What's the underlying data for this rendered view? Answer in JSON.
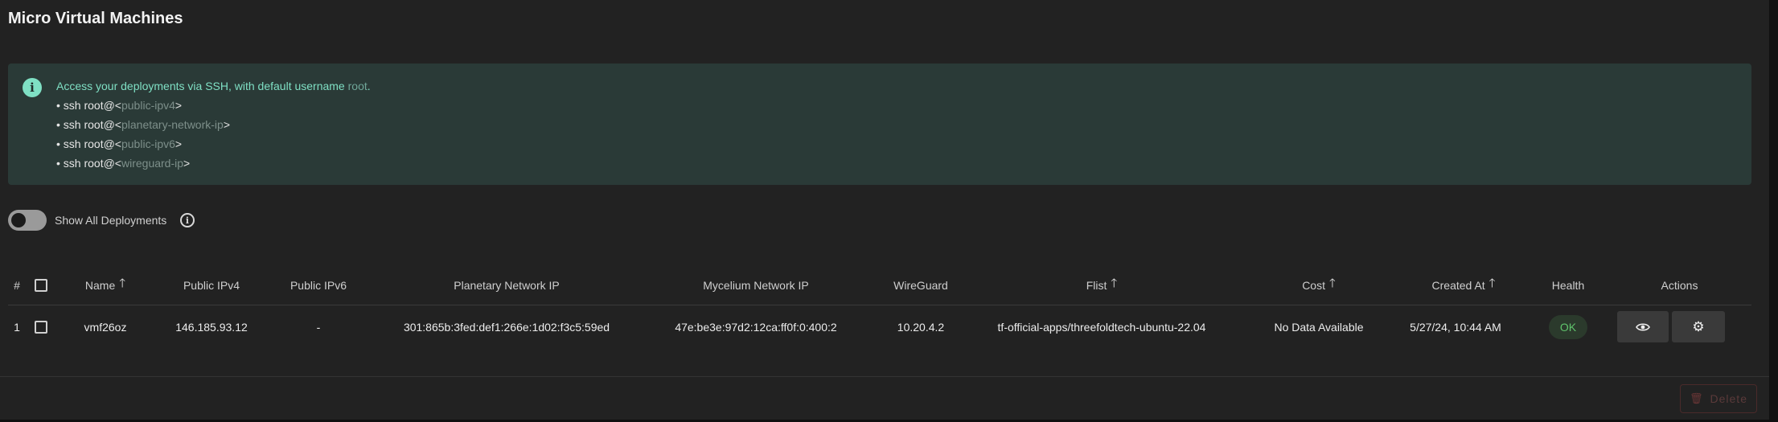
{
  "page": {
    "title": "Micro Virtual Machines"
  },
  "alert": {
    "icon": "info-icon",
    "headline_prefix": "Access your deployments via SSH, with default username ",
    "headline_user": "root",
    "headline_suffix": ".",
    "lines": [
      {
        "bullet": "• ssh root@<",
        "placeholder": "public-ipv4",
        "close": ">"
      },
      {
        "bullet": "• ssh root@<",
        "placeholder": "planetary-network-ip",
        "close": ">"
      },
      {
        "bullet": "• ssh root@<",
        "placeholder": "public-ipv6",
        "close": ">"
      },
      {
        "bullet": "• ssh root@<",
        "placeholder": "wireguard-ip",
        "close": ">"
      }
    ]
  },
  "toggle": {
    "label": "Show All Deployments",
    "checked": false,
    "info_icon": "info-icon"
  },
  "table": {
    "headers": {
      "index": "#",
      "name": "Name",
      "ipv4": "Public IPv4",
      "ipv6": "Public IPv6",
      "planetary": "Planetary Network IP",
      "mycelium": "Mycelium Network IP",
      "wireguard": "WireGuard",
      "flist": "Flist",
      "cost": "Cost",
      "created": "Created At",
      "health": "Health",
      "actions": "Actions"
    },
    "sort_icon": "arrow-up-icon",
    "rows": [
      {
        "index": "1",
        "name": "vmf26oz",
        "ipv4": "146.185.93.12",
        "ipv6": "-",
        "planetary": "301:865b:3fed:def1:266e:1d02:f3c5:59ed",
        "mycelium": "47e:be3e:97d2:12ca:ff0f:0:400:2",
        "wireguard": "10.20.4.2",
        "flist": "tf-official-apps/threefoldtech-ubuntu-22.04",
        "cost": "No Data Available",
        "created": "5/27/24, 10:44 AM",
        "health": "OK",
        "actions": [
          "eye-icon",
          "gear-icon"
        ]
      }
    ]
  },
  "footer": {
    "delete_label": "Delete",
    "delete_icon": "trash-icon"
  },
  "colors": {
    "background": "#222222",
    "alert_bg": "#2a3a37",
    "accent": "#7fe0c4",
    "health_ok": "#5fc36b"
  }
}
